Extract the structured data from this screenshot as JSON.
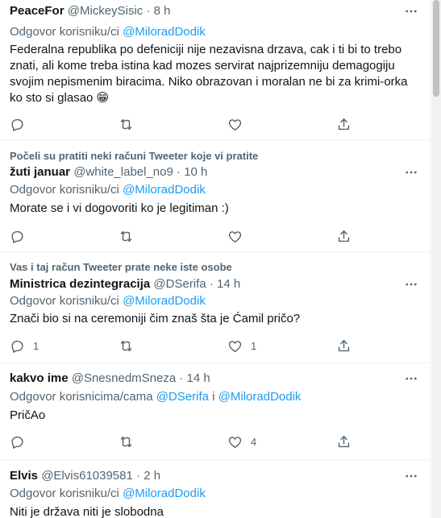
{
  "tweets": [
    {
      "author": "PeaceFor",
      "handle": "@MickeySisic",
      "time": "8 h",
      "reply_prefix": "Odgovor korisniku/ci",
      "mentions": [
        "@MiloradDodik"
      ],
      "text": "Federalna republika po defeniciji nije nezavisna drzava, cak i ti bi to trebo znati, ali kome treba istina kad mozes servirat najprizemniju demagogiju svojim nepismenim biracima. Niko obrazovan i moralan ne bi za krimi-orka ko sto si glasao 😁",
      "replies": "",
      "likes": ""
    },
    {
      "social_context": "Počeli su pratiti neki računi Tweeter koje vi pratite",
      "author": "žuti januar",
      "handle": "@white_label_no9",
      "time": "10 h",
      "reply_prefix": "Odgovor korisniku/ci",
      "mentions": [
        "@MiloradDodik"
      ],
      "text": "Morate se i vi dogovoriti ko je legitiman :)",
      "replies": "",
      "likes": ""
    },
    {
      "social_context": "Vas i taj račun Tweeter prate neke iste osobe",
      "author": "Ministrica dezintegracija",
      "handle": "@DSerifa",
      "time": "14 h",
      "reply_prefix": "Odgovor korisniku/ci",
      "mentions": [
        "@MiloradDodik"
      ],
      "text": "Znači bio si na ceremoniji čim znaš šta je Ćamil pričo?",
      "replies": "1",
      "likes": "1"
    },
    {
      "author": "kakvo ime",
      "handle": "@SnesnedmSneza",
      "time": "14 h",
      "reply_prefix": "Odgovor korisnicima/cama",
      "mentions": [
        "@DSerifa",
        "@MiloradDodik"
      ],
      "mention_join": "i",
      "text": "PričAo",
      "replies": "",
      "likes": "4"
    },
    {
      "author": "Elvis",
      "handle": "@Elvis61039581",
      "time": "2 h",
      "reply_prefix": "Odgovor korisniku/ci",
      "mentions": [
        "@MiloradDodik"
      ],
      "text": "Niti je država niti je slobodna",
      "replies": "",
      "likes": ""
    }
  ],
  "separator": "·",
  "icons": {
    "more": "more-horizontal-icon",
    "reply": "reply-bubble-icon",
    "retweet": "retweet-icon",
    "like": "heart-icon",
    "share": "share-upload-icon"
  },
  "colors": {
    "text": "#0f1419",
    "secondary": "#536471",
    "link": "#1d9bf0",
    "border": "#eff3f4"
  }
}
